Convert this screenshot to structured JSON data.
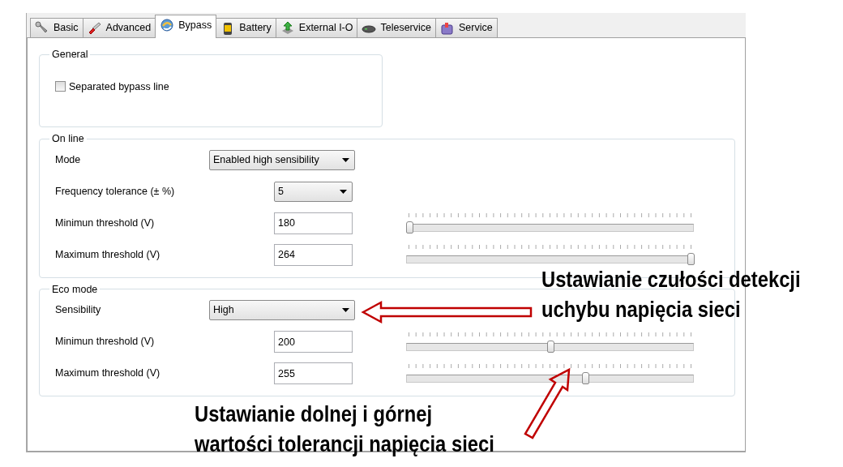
{
  "tabs": [
    {
      "label": "Basic",
      "selected": false
    },
    {
      "label": "Advanced",
      "selected": false
    },
    {
      "label": "Bypass",
      "selected": true
    },
    {
      "label": "Battery",
      "selected": false
    },
    {
      "label": "External I-O",
      "selected": false
    },
    {
      "label": "Teleservice",
      "selected": false
    },
    {
      "label": "Service",
      "selected": false
    }
  ],
  "general": {
    "title": "General",
    "checkbox": {
      "label": "Separated bypass line",
      "checked": false
    }
  },
  "sections": [
    {
      "title": "On line",
      "rows": [
        {
          "kind": "select-wide",
          "label": "Mode",
          "value": "Enabled high sensibility"
        },
        {
          "kind": "select",
          "label": "Frequency tolerance (± %)",
          "value": "5"
        },
        {
          "kind": "slider",
          "label": "Minimun threshold (V)",
          "value": "180",
          "level": 0
        },
        {
          "kind": "slider",
          "label": "Maximum threshold (V)",
          "value": "264",
          "level": 1
        }
      ]
    },
    {
      "title": "Eco mode",
      "rows": [
        {
          "kind": "select-wide",
          "label": "Sensibility",
          "value": "High"
        },
        {
          "kind": "slider",
          "label": "Minimun threshold (V)",
          "value": "200",
          "level": 0.5
        },
        {
          "kind": "slider",
          "label": "Maximum threshold (V)",
          "value": "255",
          "level": 0.625
        }
      ]
    }
  ],
  "annotations": [
    {
      "lines": [
        "Ustawianie czułości detekcji",
        "uchybu napięcia sieci"
      ]
    },
    {
      "lines": [
        "Ustawianie dolnej i górnej",
        "wartości tolerancji napięcia sieci"
      ]
    }
  ]
}
